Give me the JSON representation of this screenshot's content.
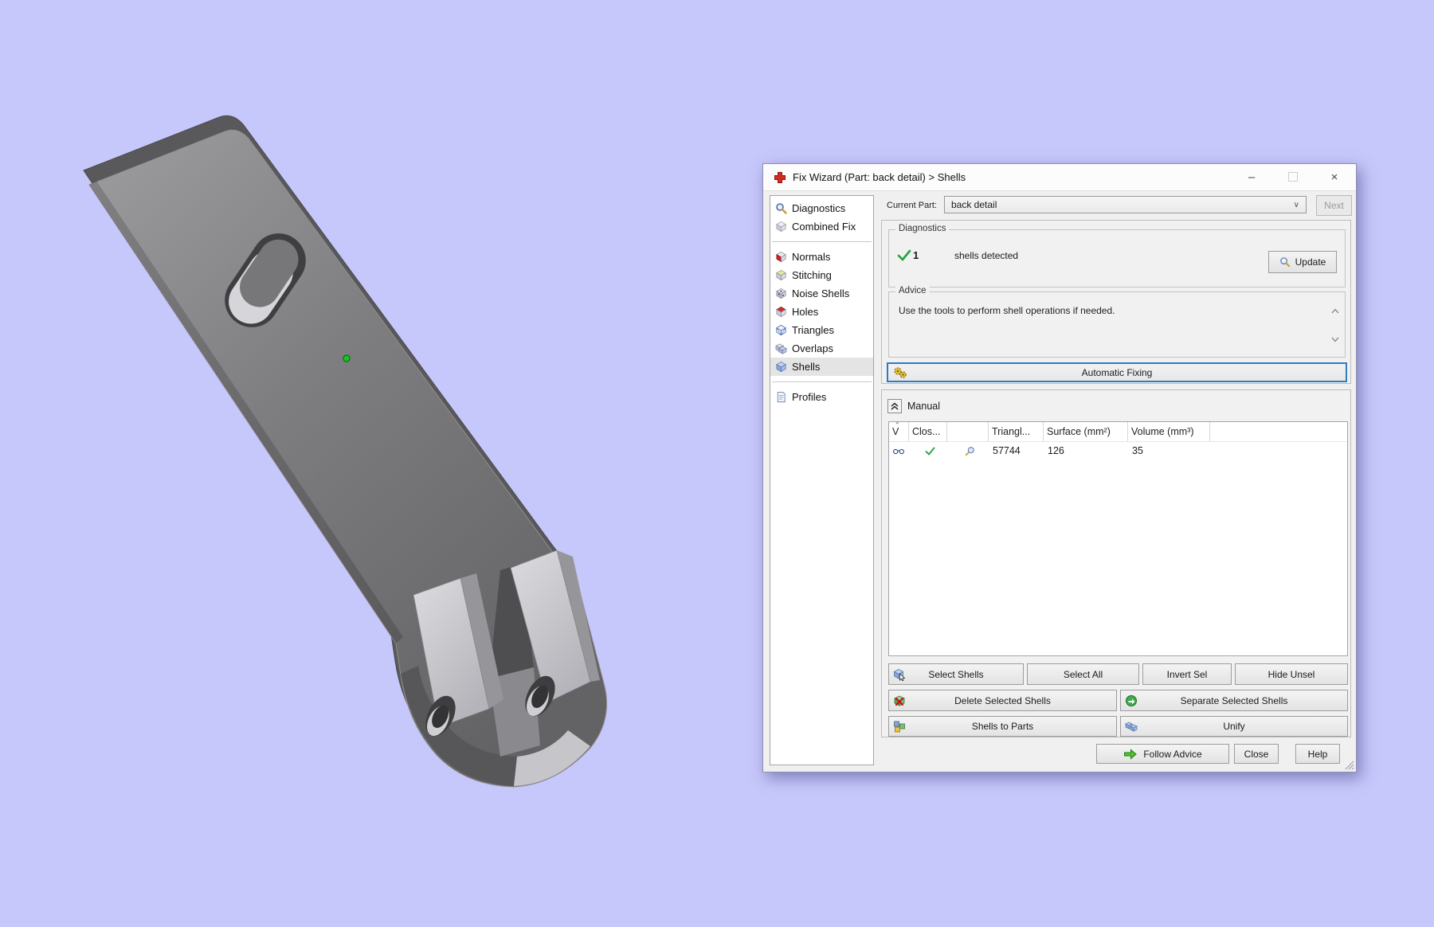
{
  "window": {
    "title": "Fix Wizard (Part: back detail) > Shells",
    "minimize_glyph": "–",
    "close_glyph": "×"
  },
  "sidebar": {
    "items": [
      {
        "label": "Diagnostics",
        "icon": "magnifier-icon"
      },
      {
        "label": "Combined Fix",
        "icon": "cube-icon"
      },
      {
        "label": "Normals",
        "icon": "cube-red-face-icon"
      },
      {
        "label": "Stitching",
        "icon": "cube-stitch-icon"
      },
      {
        "label": "Noise Shells",
        "icon": "cube-dots-icon"
      },
      {
        "label": "Holes",
        "icon": "cube-red-top-icon"
      },
      {
        "label": "Triangles",
        "icon": "cube-wireframe-icon"
      },
      {
        "label": "Overlaps",
        "icon": "cubes-overlap-icon"
      },
      {
        "label": "Shells",
        "icon": "cube-blue-icon",
        "selected": true
      },
      {
        "label": "Profiles",
        "icon": "document-icon"
      }
    ]
  },
  "current_part": {
    "label": "Current Part:",
    "value": "back detail",
    "next_label": "Next"
  },
  "diagnostics": {
    "group_label": "Diagnostics",
    "count": "1",
    "message": "shells detected",
    "update_label": "Update"
  },
  "advice": {
    "group_label": "Advice",
    "text": "Use the tools to perform shell operations if needed."
  },
  "automatic_fixing_label": "Automatic Fixing",
  "manual": {
    "label": "Manual",
    "table": {
      "columns": [
        "V",
        "Clos...",
        "",
        "Triangl...",
        "Surface (mm²)",
        "Volume (mm³)"
      ],
      "rows": [
        {
          "visible": "glasses-icon",
          "closed": "check-icon",
          "inspect": "magnifier-icon",
          "triangles": "57744",
          "surface": "126",
          "volume": "35"
        }
      ]
    },
    "buttons_row1": [
      "Select Shells",
      "Select All",
      "Invert Sel",
      "Hide Unsel"
    ],
    "buttons_row2": [
      "Delete Selected Shells",
      "Separate Selected Shells"
    ],
    "buttons_row3": [
      "Shells to Parts",
      "Unify"
    ]
  },
  "footer": {
    "follow_advice": "Follow Advice",
    "close": "Close",
    "help": "Help"
  },
  "colors": {
    "background": "#c6c7fa",
    "accent_blue": "#2e7cc2",
    "check_green": "#1fa33c",
    "model_gray": "#78787a"
  }
}
